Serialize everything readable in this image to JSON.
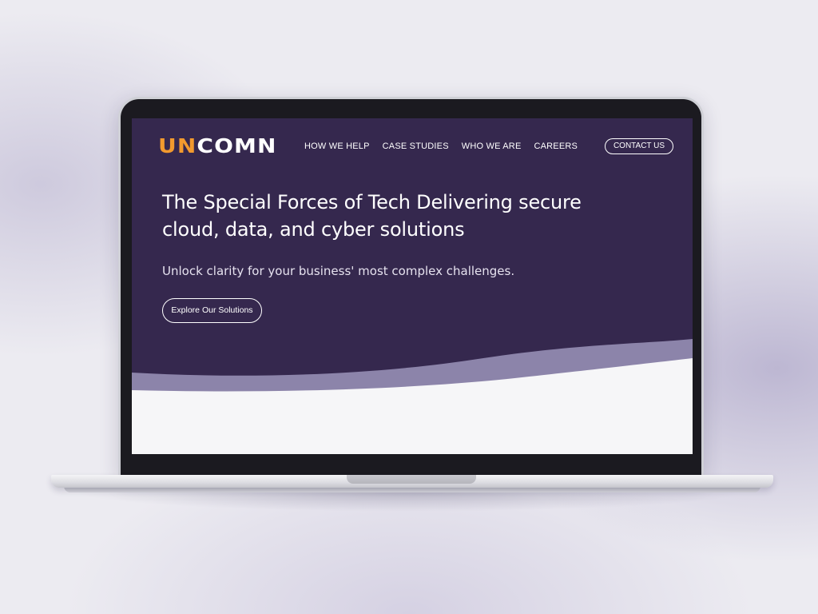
{
  "site": {
    "logo": {
      "part1": "UN",
      "part2": "COMN"
    },
    "nav": {
      "items": [
        {
          "label": "HOW WE HELP"
        },
        {
          "label": "CASE STUDIES"
        },
        {
          "label": "WHO WE ARE"
        },
        {
          "label": "CAREERS"
        }
      ]
    },
    "contact_label": "CONTACT US",
    "hero": {
      "title": "The Special Forces of Tech Delivering secure cloud, data, and cyber solutions",
      "subtitle": "Unlock clarity for your business' most complex challenges.",
      "cta_label": "Explore Our Solutions"
    }
  },
  "colors": {
    "hero_background": "#35284e",
    "logo_accent": "#f29a2e",
    "wave_band": "#8c84aa",
    "page_background": "#f6f6f8"
  }
}
